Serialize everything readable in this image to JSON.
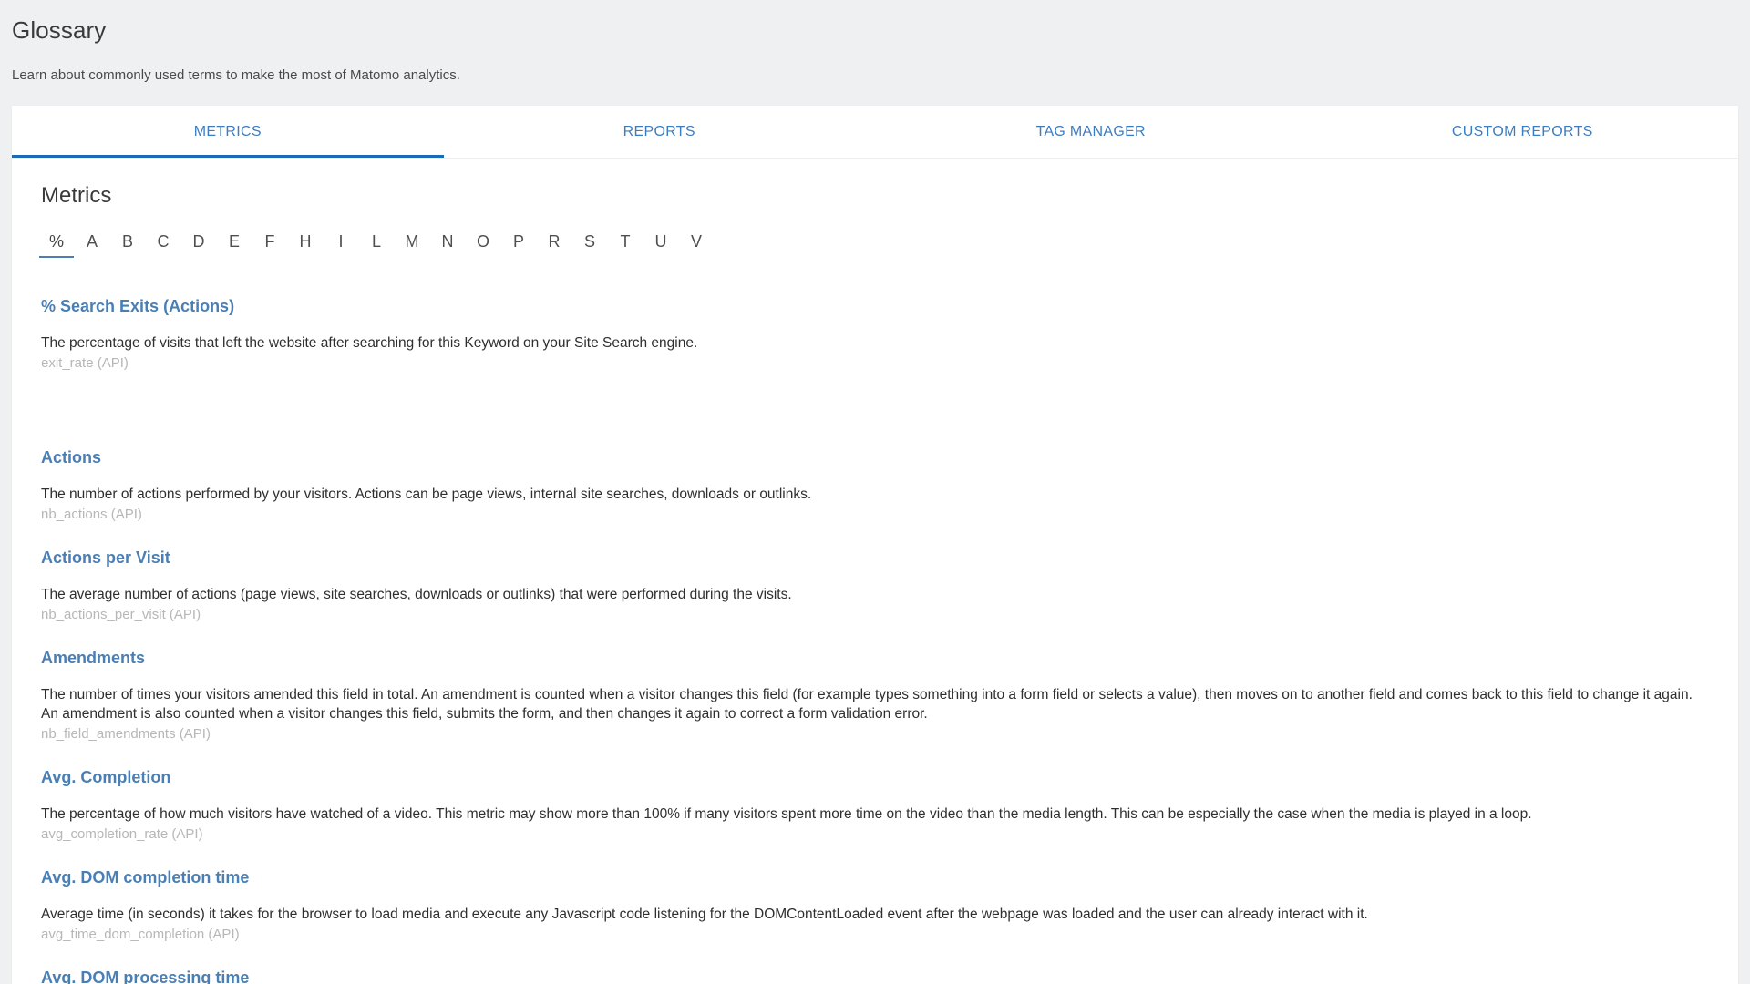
{
  "header": {
    "title": "Glossary",
    "subtitle": "Learn about commonly used terms to make the most of Matomo analytics."
  },
  "tabs": [
    {
      "label": "METRICS",
      "active": true
    },
    {
      "label": "REPORTS",
      "active": false
    },
    {
      "label": "TAG MANAGER",
      "active": false
    },
    {
      "label": "CUSTOM REPORTS",
      "active": false
    }
  ],
  "section": {
    "title": "Metrics"
  },
  "alphabet": [
    {
      "label": "%",
      "active": true
    },
    {
      "label": "A",
      "active": false
    },
    {
      "label": "B",
      "active": false
    },
    {
      "label": "C",
      "active": false
    },
    {
      "label": "D",
      "active": false
    },
    {
      "label": "E",
      "active": false
    },
    {
      "label": "F",
      "active": false
    },
    {
      "label": "H",
      "active": false
    },
    {
      "label": "I",
      "active": false
    },
    {
      "label": "L",
      "active": false
    },
    {
      "label": "M",
      "active": false
    },
    {
      "label": "N",
      "active": false
    },
    {
      "label": "O",
      "active": false
    },
    {
      "label": "P",
      "active": false
    },
    {
      "label": "R",
      "active": false
    },
    {
      "label": "S",
      "active": false
    },
    {
      "label": "T",
      "active": false
    },
    {
      "label": "U",
      "active": false
    },
    {
      "label": "V",
      "active": false
    }
  ],
  "entries": [
    {
      "name": "% Search Exits (Actions)",
      "description": "The percentage of visits that left the website after searching for this Keyword on your Site Search engine.",
      "api": "exit_rate (API)",
      "extra_gap": true
    },
    {
      "name": "Actions",
      "description": "The number of actions performed by your visitors. Actions can be page views, internal site searches, downloads or outlinks.",
      "api": "nb_actions (API)",
      "extra_gap": false
    },
    {
      "name": "Actions per Visit",
      "description": "The average number of actions (page views, site searches, downloads or outlinks) that were performed during the visits.",
      "api": "nb_actions_per_visit (API)",
      "extra_gap": false
    },
    {
      "name": "Amendments",
      "description": "The number of times your visitors amended this field in total. An amendment is counted when a visitor changes this field (for example types something into a form field or selects a value), then moves on to another field and comes back to this field to change it again. An amendment is also counted when a visitor changes this field, submits the form, and then changes it again to correct a form validation error.",
      "api": "nb_field_amendments (API)",
      "extra_gap": false
    },
    {
      "name": "Avg. Completion",
      "description": "The percentage of how much visitors have watched of a video. This metric may show more than 100% if many visitors spent more time on the video than the media length. This can be especially the case when the media is played in a loop.",
      "api": "avg_completion_rate (API)",
      "extra_gap": false
    },
    {
      "name": "Avg. DOM completion time",
      "description": "Average time (in seconds) it takes for the browser to load media and execute any Javascript code listening for the DOMContentLoaded event after the webpage was loaded and the user can already interact with it.",
      "api": "avg_time_dom_completion (API)",
      "extra_gap": false
    },
    {
      "name": "Avg. DOM processing time",
      "description": "",
      "api": "",
      "extra_gap": false
    }
  ],
  "colors": {
    "accent": "#3c7cc1",
    "link": "#4a7fb5",
    "indicator": "#1a6bb5",
    "page_background": "#eff0f1",
    "card_background": "#ffffff",
    "api_text": "#b7b7b7"
  }
}
